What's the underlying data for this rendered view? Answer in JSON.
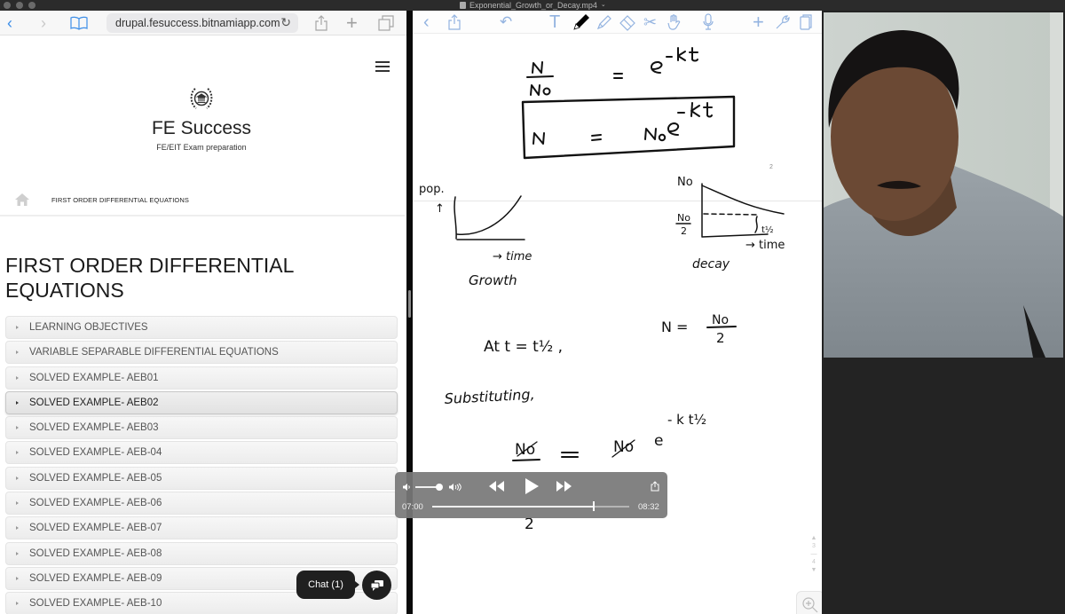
{
  "window": {
    "video_filename": "Exponential_Growth_or_Decay.mp4",
    "file_icon": "document-icon",
    "dropdown_icon": "chevron-down-icon"
  },
  "safari": {
    "url": "drupal.fesuccess.bitnamiapp.com",
    "icons": {
      "back": "chevron-left-icon",
      "forward": "chevron-right-icon",
      "bookmarks": "book-icon",
      "reload": "reload-icon",
      "share": "share-icon",
      "new_tab": "plus-icon",
      "tabs": "tabs-icon"
    }
  },
  "site": {
    "brand_title": "FE Success",
    "brand_subtitle": "FE/EIT Exam preparation",
    "menu_icon": "hamburger-icon",
    "breadcrumb": "FIRST ORDER DIFFERENTIAL EQUATIONS",
    "page_title": "FIRST ORDER DIFFERENTIAL EQUATIONS",
    "accordion": [
      {
        "label": "LEARNING OBJECTIVES",
        "active": false
      },
      {
        "label": "VARIABLE SEPARABLE DIFFERENTIAL EQUATIONS",
        "active": false
      },
      {
        "label": "SOLVED EXAMPLE- AEB01",
        "active": false
      },
      {
        "label": "SOLVED EXAMPLE- AEB02",
        "active": true
      },
      {
        "label": "SOLVED EXAMPLE- AEB03",
        "active": false
      },
      {
        "label": "SOLVED EXAMPLE- AEB-04",
        "active": false
      },
      {
        "label": "SOLVED EXAMPLE- AEB-05",
        "active": false
      },
      {
        "label": "SOLVED EXAMPLE- AEB-06",
        "active": false
      },
      {
        "label": "SOLVED EXAMPLE- AEB-07",
        "active": false
      },
      {
        "label": "SOLVED EXAMPLE- AEB-08",
        "active": false
      },
      {
        "label": "SOLVED EXAMPLE- AEB-09",
        "active": false
      },
      {
        "label": "SOLVED EXAMPLE- AEB-10",
        "active": false
      }
    ],
    "chat_label": "Chat (1)"
  },
  "notes": {
    "toolbar_icons": [
      "back-icon",
      "share-icon",
      "undo-icon",
      "text-tool-icon",
      "pen-icon",
      "highlighter-icon",
      "eraser-icon",
      "scissors-icon",
      "hand-icon",
      "microphone-icon",
      "add-icon",
      "wrench-icon",
      "pages-icon"
    ],
    "page_number": "2",
    "pager_current": "3",
    "pager_total": "4",
    "handwriting": {
      "eq1": "N / No = e^(-kt)",
      "eq2_boxed": "N = No e^(-kt)",
      "growth_ylabel": "pop.",
      "growth_xlabel": "time",
      "growth_caption": "Growth",
      "decay_y_top": "No",
      "decay_y_half": "No / 2",
      "decay_marker": "t1/2",
      "decay_xlabel": "time",
      "decay_caption": "decay",
      "line_at": "At t = t1/2 ,",
      "line_n": "N = No / 2",
      "substituting": "Substituting,",
      "eq3": "No/2 = No e^(-k t1/2)"
    }
  },
  "player": {
    "current_time": "07:00",
    "duration": "08:32",
    "progress_fraction": 0.82,
    "volume_fraction": 0.9
  }
}
